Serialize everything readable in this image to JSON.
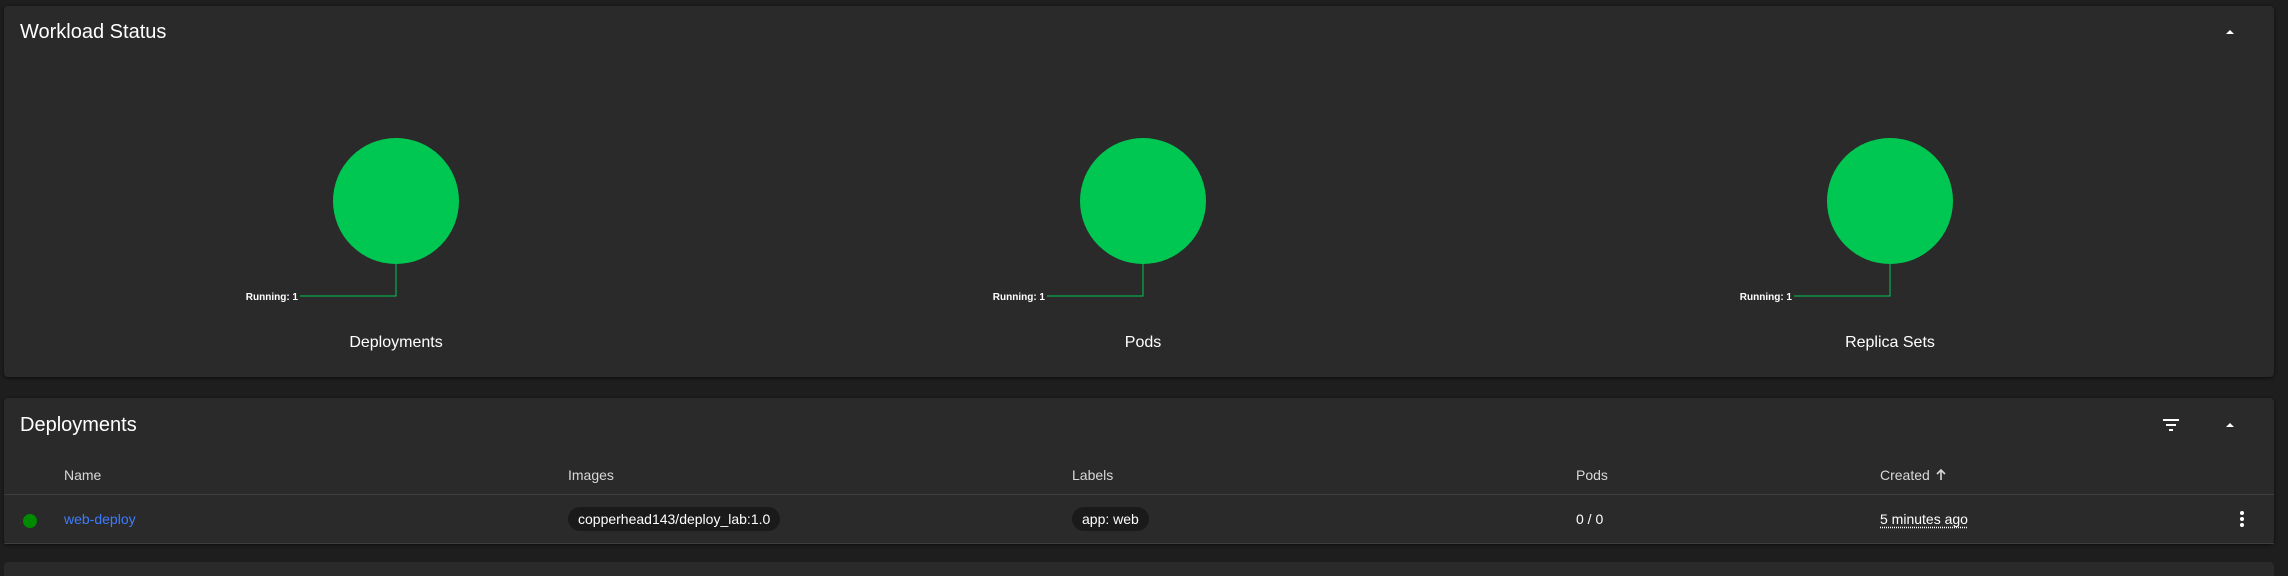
{
  "workload_status": {
    "title": "Workload Status",
    "collapse_icon": "chevron-up-icon"
  },
  "chart_data": [
    {
      "type": "pie",
      "caption": "Deployments",
      "slices": [
        {
          "name": "Running",
          "value": 1,
          "color": "#00c752"
        }
      ],
      "label": "Running: 1"
    },
    {
      "type": "pie",
      "caption": "Pods",
      "slices": [
        {
          "name": "Running",
          "value": 1,
          "color": "#00c752"
        }
      ],
      "label": "Running: 1"
    },
    {
      "type": "pie",
      "caption": "Replica Sets",
      "slices": [
        {
          "name": "Running",
          "value": 1,
          "color": "#00c752"
        }
      ],
      "label": "Running: 1"
    }
  ],
  "deployments": {
    "title": "Deployments",
    "filter_icon": "filter-icon",
    "collapse_icon": "chevron-up-icon",
    "columns": [
      "Name",
      "Images",
      "Labels",
      "Pods",
      "Created"
    ],
    "sort_icon": "arrow-up-icon",
    "rows": [
      {
        "status_color": "#008a00",
        "name": "web-deploy",
        "image": "copperhead143/deploy_lab:1.0",
        "label": "app: web",
        "pods": "0 / 0",
        "created": "5 minutes ago",
        "menu_icon": "more-vertical-icon"
      }
    ]
  },
  "colors": {
    "running": "#00c752",
    "link": "#3d7bff",
    "card_bg": "#2a2a2a",
    "page_bg": "#1e1e1e"
  }
}
